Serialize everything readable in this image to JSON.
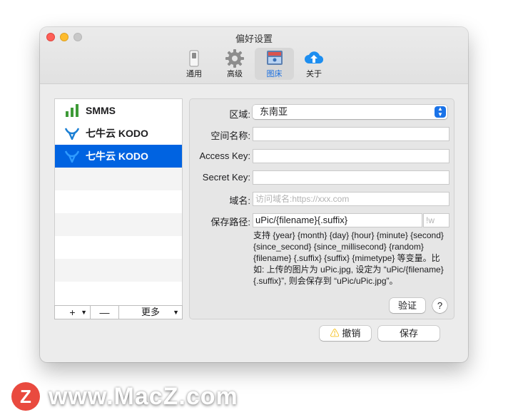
{
  "window": {
    "title": "偏好设置"
  },
  "toolbar": {
    "items": [
      {
        "label": "通用",
        "icon": "switch-icon"
      },
      {
        "label": "高级",
        "icon": "gear-icon"
      },
      {
        "label": "图床",
        "icon": "image-host-icon",
        "selected": true
      },
      {
        "label": "关于",
        "icon": "cloud-upload-icon"
      }
    ]
  },
  "host_list": {
    "items": [
      {
        "label": "SMMS",
        "icon": "signal-bars-icon"
      },
      {
        "label": "七牛云 KODO",
        "icon": "qiniu-icon"
      },
      {
        "label": "七牛云 KODO",
        "icon": "qiniu-icon",
        "selected": true
      }
    ],
    "footer": {
      "add_label": "+",
      "remove_label": "—",
      "more_label": "更多"
    }
  },
  "form": {
    "region_label": "区域:",
    "region_value": "东南亚",
    "bucket_label": "空间名称:",
    "bucket_value": "",
    "access_key_label": "Access Key:",
    "access_key_value": "",
    "secret_key_label": "Secret Key:",
    "secret_key_value": "",
    "domain_label": "域名:",
    "domain_placeholder": "访问域名:https://xxx.com",
    "path_label": "保存路径:",
    "path_value": "uPic/{filename}{.suffix}",
    "path_suffix_placeholder": "!w",
    "help_text": "支持 {year} {month} {day} {hour} {minute} {second} {since_second} {since_millisecond} {random} {filename} {.suffix} {suffix} {mimetype} 等变量。比如: 上传的图片为 uPic.jpg, 设定为 “uPic/{filename}{.suffix}”, 则会保存到 “uPic/uPic.jpg”。",
    "verify_label": "验证",
    "help_button_label": "?"
  },
  "actions": {
    "cancel_label": "撤销",
    "save_label": "保存"
  },
  "watermark": {
    "logo_letter": "Z",
    "text": "www.MacZ.com"
  },
  "colors": {
    "accent": "#0063e1",
    "close": "#fe5f57",
    "minimize": "#febc2e"
  }
}
